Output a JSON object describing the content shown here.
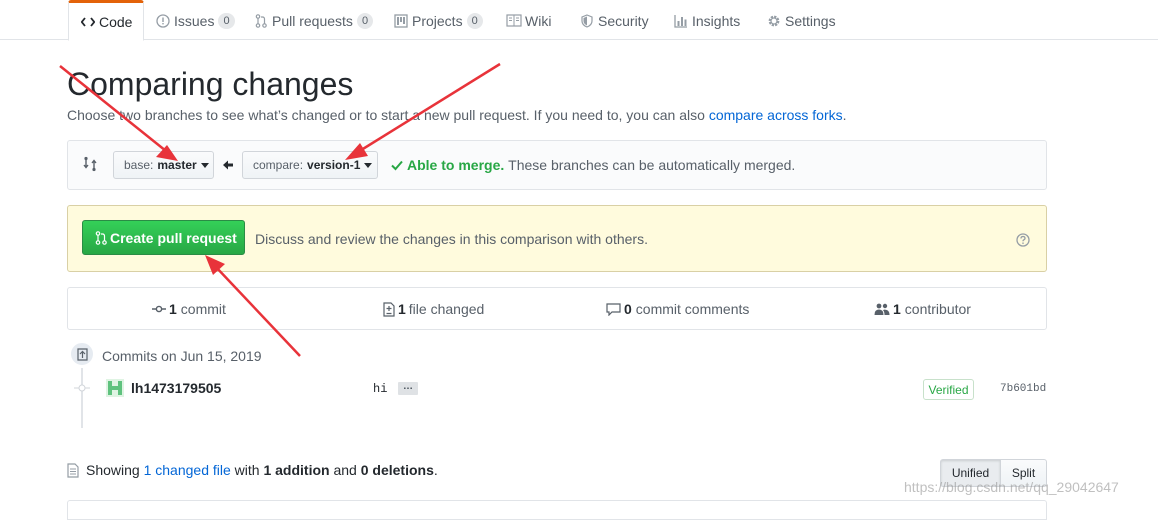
{
  "tabs": [
    {
      "label": "Code",
      "icon": "code-icon",
      "selected": true
    },
    {
      "label": "Issues",
      "icon": "issue-icon",
      "count": "0"
    },
    {
      "label": "Pull requests",
      "icon": "git-pull-request-icon",
      "count": "0"
    },
    {
      "label": "Projects",
      "icon": "project-icon",
      "count": "0"
    },
    {
      "label": "Wiki",
      "icon": "book-icon"
    },
    {
      "label": "Security",
      "icon": "shield-icon"
    },
    {
      "label": "Insights",
      "icon": "graph-icon"
    },
    {
      "label": "Settings",
      "icon": "gear-icon"
    }
  ],
  "header": {
    "title": "Comparing changes",
    "desc_prefix": "Choose two branches to see what’s changed or to start a new pull request. If you need to, you can also ",
    "desc_link": "compare across forks",
    "desc_suffix": "."
  },
  "range_editor": {
    "base_label": "base:",
    "base_value": "master",
    "compare_label": "compare:",
    "compare_value": "version-1",
    "merge_status": "Able to merge.",
    "merge_message": "These branches can be automatically merged."
  },
  "create_pr": {
    "button_label": "Create pull request",
    "message": "Discuss and review the changes in this comparison with others."
  },
  "stats": {
    "commits_count": "1",
    "commits_label": "commit",
    "files_count": "1",
    "files_label": "file changed",
    "comments_count": "0",
    "comments_label": "commit comments",
    "contributors_count": "1",
    "contributors_label": "contributor"
  },
  "commits": {
    "group_title": "Commits on Jun 15, 2019",
    "items": [
      {
        "author": "lh1473179505",
        "message": "hi",
        "ellipsis": "…",
        "badge": "Verified",
        "sha": "7b601bd"
      }
    ]
  },
  "files_summary": {
    "prefix": "Showing ",
    "link": "1 changed file",
    "middle": " with ",
    "additions": "1 addition",
    "and": " and ",
    "deletions": "0 deletions",
    "suffix": "."
  },
  "diff_view": {
    "unified": "Unified",
    "split": "Split",
    "selected": "Unified"
  },
  "watermark": "https://blog.csdn.net/qq_29042647",
  "colors": {
    "link": "#0366d6",
    "success": "#28a745",
    "flash_bg": "#fffbdd",
    "flash_border": "#d9d0a5",
    "arrow": "#e8333a",
    "tab_accent": "#e36209"
  }
}
